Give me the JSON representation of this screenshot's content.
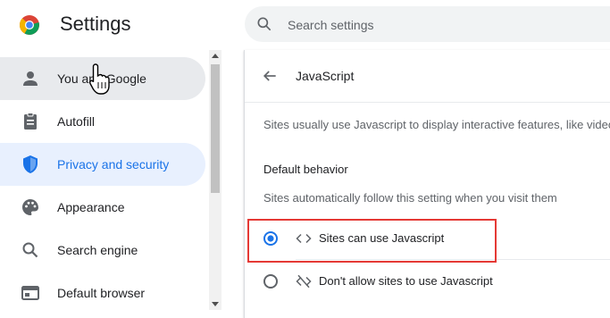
{
  "header": {
    "app_title": "Settings",
    "search_placeholder": "Search settings"
  },
  "sidebar": {
    "items": [
      {
        "label": "You and Google",
        "icon": "person-icon",
        "state": "hover"
      },
      {
        "label": "Autofill",
        "icon": "clipboard-icon",
        "state": "normal"
      },
      {
        "label": "Privacy and security",
        "icon": "shield-icon",
        "state": "active"
      },
      {
        "label": "Appearance",
        "icon": "palette-icon",
        "state": "normal"
      },
      {
        "label": "Search engine",
        "icon": "search-icon",
        "state": "normal"
      },
      {
        "label": "Default browser",
        "icon": "browser-window-icon",
        "state": "normal"
      }
    ]
  },
  "main": {
    "title": "JavaScript",
    "description": "Sites usually use Javascript to display interactive features, like video games or web forms",
    "default_behavior": {
      "heading": "Default behavior",
      "subheading": "Sites automatically follow this setting when you visit them",
      "options": [
        {
          "label": "Sites can use Javascript",
          "icon": "code-icon",
          "selected": true
        },
        {
          "label": "Don't allow sites to use Javascript",
          "icon": "code-off-icon",
          "selected": false
        }
      ]
    }
  },
  "colors": {
    "accent": "#1a73e8",
    "active_bg": "#e8f0fe",
    "hover_bg": "#e8eaed",
    "highlight_border": "#e53935"
  }
}
